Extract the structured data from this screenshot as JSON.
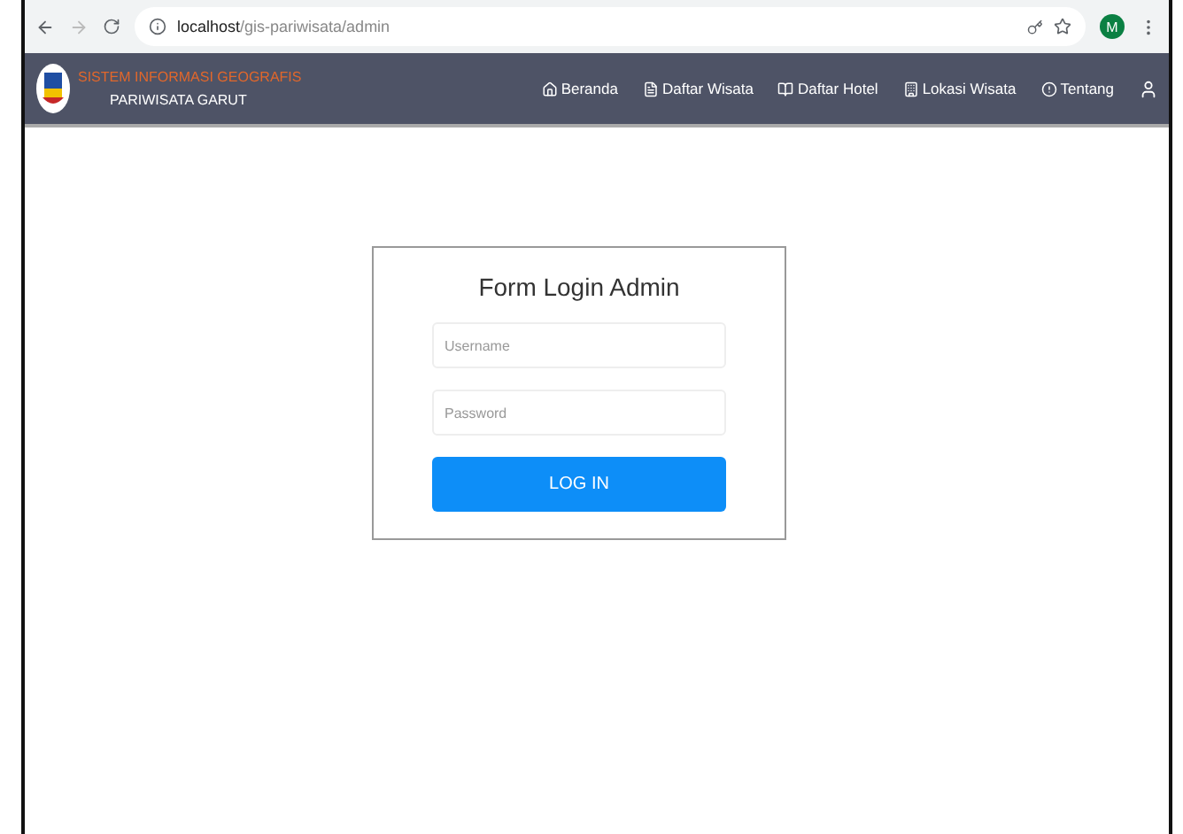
{
  "browser": {
    "url_host": "localhost",
    "url_path": "/gis-pariwisata/admin",
    "profile_initial": "M"
  },
  "navbar": {
    "title": "SISTEM INFORMASI GEOGRAFIS",
    "subtitle": "PARIWISATA GARUT",
    "items": [
      {
        "kind": "home",
        "label": "Beranda"
      },
      {
        "kind": "list",
        "label": "Daftar Wisata"
      },
      {
        "kind": "hotel",
        "label": "Daftar Hotel"
      },
      {
        "kind": "location",
        "label": "Lokasi Wisata"
      },
      {
        "kind": "info",
        "label": "Tentang"
      },
      {
        "kind": "user"
      }
    ]
  },
  "login": {
    "title": "Form Login Admin",
    "username": {
      "placeholder": "Username"
    },
    "password": {
      "placeholder": "Password"
    },
    "submit": "LOG IN"
  }
}
